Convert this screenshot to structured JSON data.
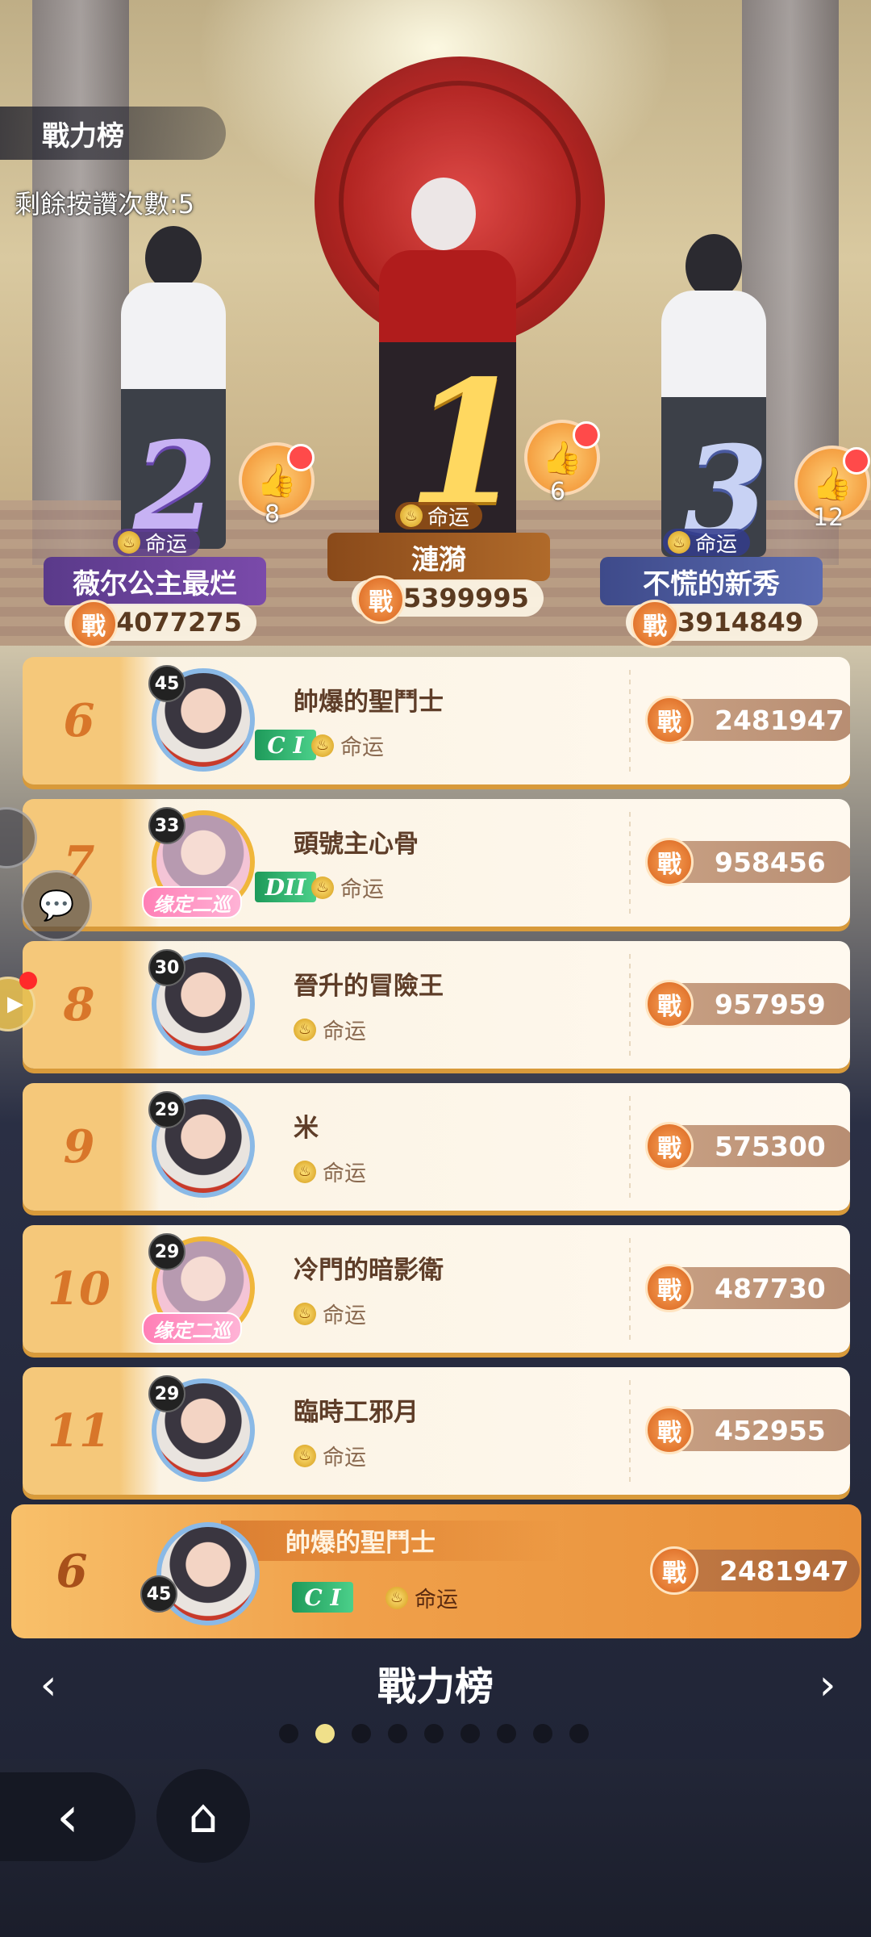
{
  "header": {
    "title": "戰力榜",
    "likes_remaining": "剩餘按讚次數:5"
  },
  "podium": [
    {
      "rank": "2",
      "name": "薇尔公主最烂",
      "fate": "命运",
      "power": "4077275",
      "likes": "8",
      "name_color": "#5a3a7a"
    },
    {
      "rank": "1",
      "name": "漣漪",
      "fate": "命运",
      "power": "5399995",
      "likes": "6",
      "name_color": "#8a4a1a"
    },
    {
      "rank": "3",
      "name": "不慌的新秀",
      "fate": "命运",
      "power": "3914849",
      "likes": "12",
      "name_color": "#3e4a8a"
    }
  ],
  "power_icon": "戰",
  "rows": [
    {
      "rank": "6",
      "level": "45",
      "name": "帥爆的聖鬥士",
      "badge": "C I",
      "fate": "命运",
      "power": "2481947",
      "frame": ""
    },
    {
      "rank": "7",
      "level": "33",
      "name": "頭號主心骨",
      "badge": "DII",
      "fate": "命运",
      "power": "958456",
      "frame": "缘定二巡"
    },
    {
      "rank": "8",
      "level": "30",
      "name": "晉升的冒險王",
      "badge": "",
      "fate": "命运",
      "power": "957959",
      "frame": ""
    },
    {
      "rank": "9",
      "level": "29",
      "name": "米",
      "badge": "",
      "fate": "命运",
      "power": "575300",
      "frame": ""
    },
    {
      "rank": "10",
      "level": "29",
      "name": "冷門的暗影衛",
      "badge": "",
      "fate": "命运",
      "power": "487730",
      "frame": "缘定二巡"
    },
    {
      "rank": "11",
      "level": "29",
      "name": "臨時工邪月",
      "badge": "",
      "fate": "命运",
      "power": "452955",
      "frame": ""
    }
  ],
  "my_rank": {
    "rank": "6",
    "level": "45",
    "name": "帥爆的聖鬥士",
    "badge": "C I",
    "fate": "命运",
    "power": "2481947"
  },
  "footer": {
    "title": "戰力榜",
    "page_count": 9,
    "active_page": 2
  },
  "icons": {
    "prev": "chevron-left-icon",
    "next": "chevron-right-icon",
    "back": "back-arrow-icon",
    "home": "home-icon",
    "chat": "chat-icon",
    "like": "thumbs-up-icon",
    "fate": "flame-icon"
  }
}
